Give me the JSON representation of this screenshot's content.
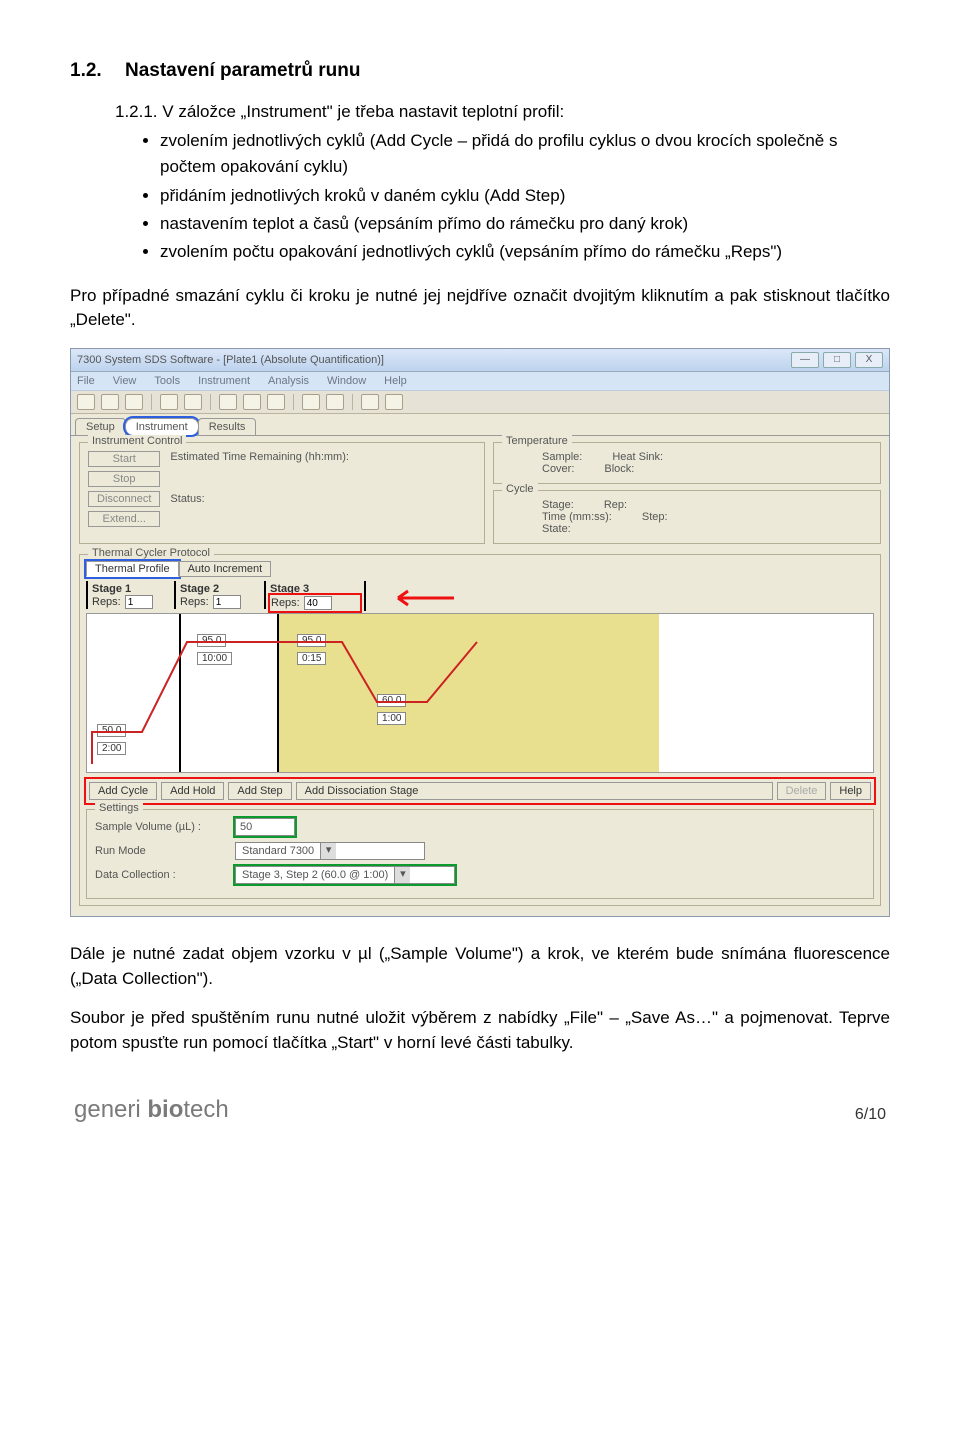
{
  "doc": {
    "heading_num": "1.2.",
    "heading_text": "Nastavení parametrů runu",
    "intro": "1.2.1. V záložce „Instrument\" je třeba nastavit teplotní profil:",
    "bullets": [
      "zvolením jednotlivých cyklů (Add Cycle – přidá do profilu cyklus o dvou krocích společně s počtem opakování cyklu)",
      "přidáním jednotlivých kroků v daném cyklu (Add Step)",
      "nastavením teplot a časů (vepsáním přímo do rámečku pro daný krok)",
      "zvolením počtu opakování jednotlivých cyklů (vepsáním přímo do rámečku „Reps\")"
    ],
    "p1": "Pro případné smazání cyklu či kroku je nutné jej nejdříve označit dvojitým kliknutím a pak stisknout tlačítko „Delete\".",
    "p2": "Dále je nutné zadat objem vzorku v µl („Sample Volume\") a krok, ve kterém bude snímána fluorescence („Data Collection\").",
    "p3": "Soubor je před spuštěním runu nutné uložit výběrem z nabídky „File\" – „Save As…\" a pojmenovat. Teprve potom spusťte run pomocí tlačítka „Start\" v horní levé části tabulky."
  },
  "win": {
    "title": "7300 System SDS Software - [Plate1 (Absolute Quantification)]",
    "menus": [
      "File",
      "View",
      "Tools",
      "Instrument",
      "Analysis",
      "Window",
      "Help"
    ],
    "maintabs": [
      "Setup",
      "Instrument",
      "Results"
    ],
    "instr_control": {
      "legend": "Instrument Control",
      "buttons": [
        "Start",
        "Stop",
        "Disconnect",
        "Extend..."
      ],
      "etr_label": "Estimated Time Remaining (hh:mm):",
      "status_label": "Status:"
    },
    "temperature": {
      "legend": "Temperature",
      "sample": "Sample:",
      "cover": "Cover:",
      "heatsink": "Heat Sink:",
      "block": "Block:"
    },
    "cycle": {
      "legend": "Cycle",
      "stage": "Stage:",
      "rep": "Rep:",
      "time": "Time (mm:ss):",
      "step": "Step:",
      "state": "State:"
    },
    "thermal": {
      "legend": "Thermal Cycler Protocol",
      "tabs": [
        "Thermal Profile",
        "Auto Increment"
      ],
      "stages": [
        {
          "name": "Stage 1",
          "reps": "1"
        },
        {
          "name": "Stage 2",
          "reps": "1"
        },
        {
          "name": "Stage 3",
          "reps": "40"
        }
      ],
      "steps": {
        "s1": {
          "temp": "50.0",
          "time": "2:00"
        },
        "s2": {
          "temp": "95.0",
          "time": "10:00"
        },
        "s3a": {
          "temp": "95.0",
          "time": "0:15"
        },
        "s3b": {
          "temp": "60.0",
          "time": "1:00"
        }
      },
      "proto_buttons": [
        "Add Cycle",
        "Add Hold",
        "Add Step",
        "Add Dissociation Stage",
        "Delete",
        "Help"
      ]
    },
    "settings": {
      "legend": "Settings",
      "sample_volume_label": "Sample Volume (µL) :",
      "sample_volume_value": "50",
      "run_mode_label": "Run Mode",
      "run_mode_value": "Standard 7300",
      "data_collection_label": "Data Collection :",
      "data_collection_value": "Stage 3, Step 2 (60.0 @ 1:00)"
    }
  },
  "footer": {
    "brand_a": "generi ",
    "brand_b": "bio",
    "brand_c": "tech",
    "page": "6/10"
  }
}
